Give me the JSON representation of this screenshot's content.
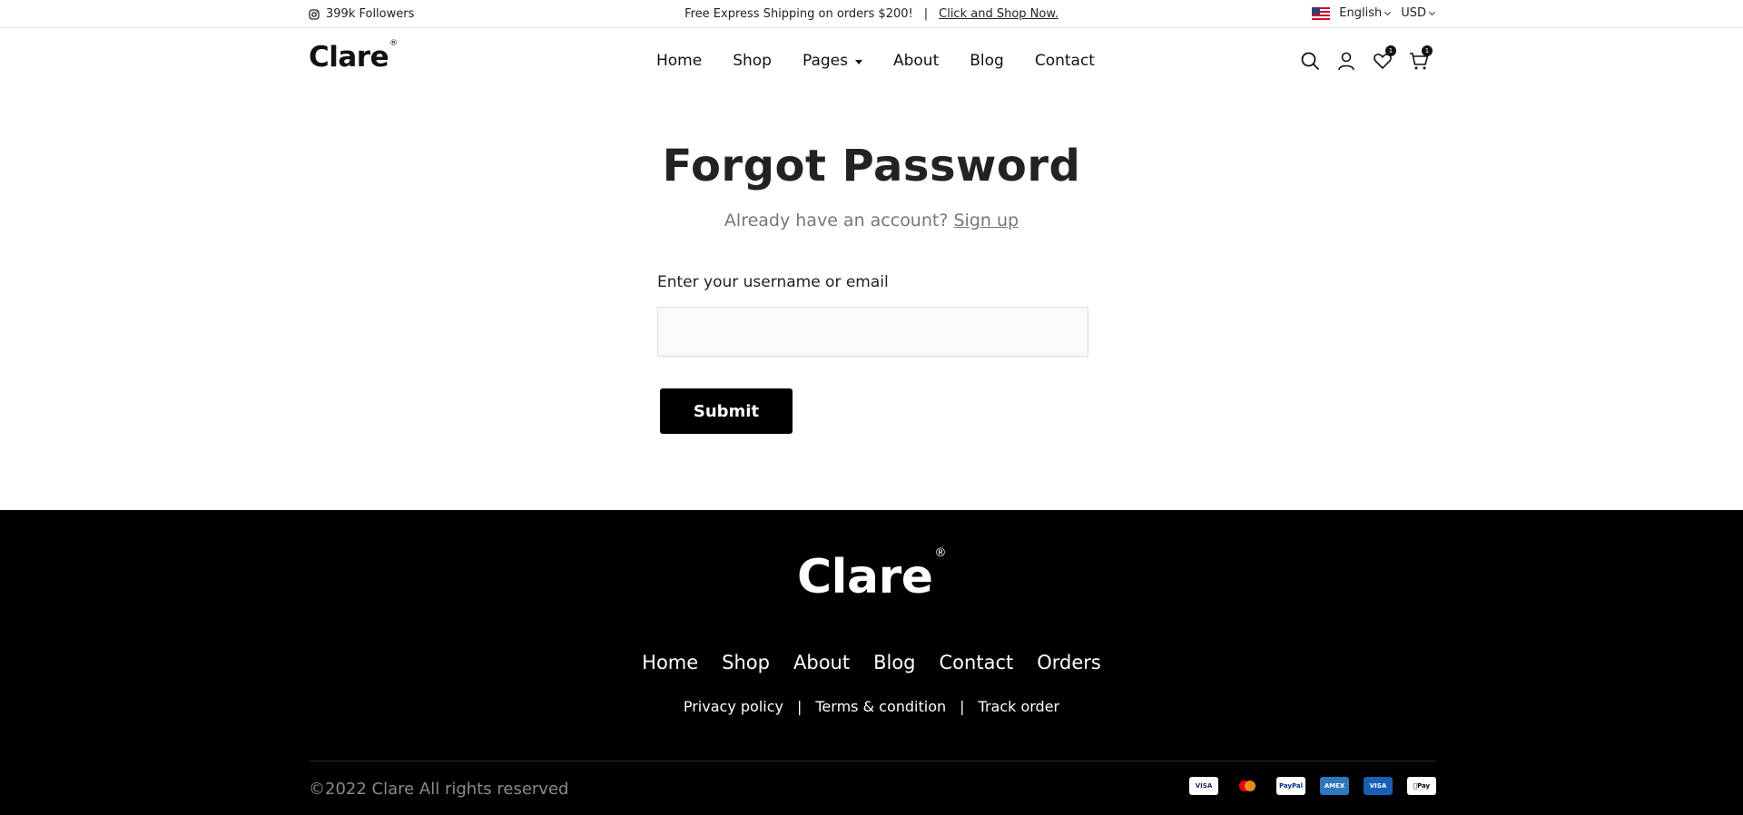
{
  "topbar": {
    "followers": "399k Followers",
    "promo_text": "Free Express Shipping on orders $200!",
    "promo_sep": "|",
    "promo_link": "Click and Shop Now.",
    "language": "English",
    "currency": "USD"
  },
  "header": {
    "logo": "Clare",
    "logo_mark": "®",
    "nav": [
      "Home",
      "Shop",
      "Pages",
      "About",
      "Blog",
      "Contact"
    ],
    "wishlist_count": "1",
    "cart_count": "1"
  },
  "main": {
    "title": "Forgot Password",
    "subtitle": "Already have an account?",
    "signup_link": "Sign up",
    "field_label": "Enter your username or email",
    "field_value": "",
    "submit_label": "Submit"
  },
  "footer": {
    "logo": "Clare",
    "logo_mark": "®",
    "nav": [
      "Home",
      "Shop",
      "About",
      "Blog",
      "Contact",
      "Orders"
    ],
    "links": [
      "Privacy policy",
      "Terms & condition",
      "Track order"
    ],
    "links_sep": "|",
    "copyright": "©2022 Clare All rights reserved",
    "payments": [
      "VISA",
      "mastercard",
      "PayPal",
      "AMEX",
      "VISA",
      "Pay"
    ]
  },
  "colors": {
    "accent": "#000000",
    "muted": "#777777"
  }
}
